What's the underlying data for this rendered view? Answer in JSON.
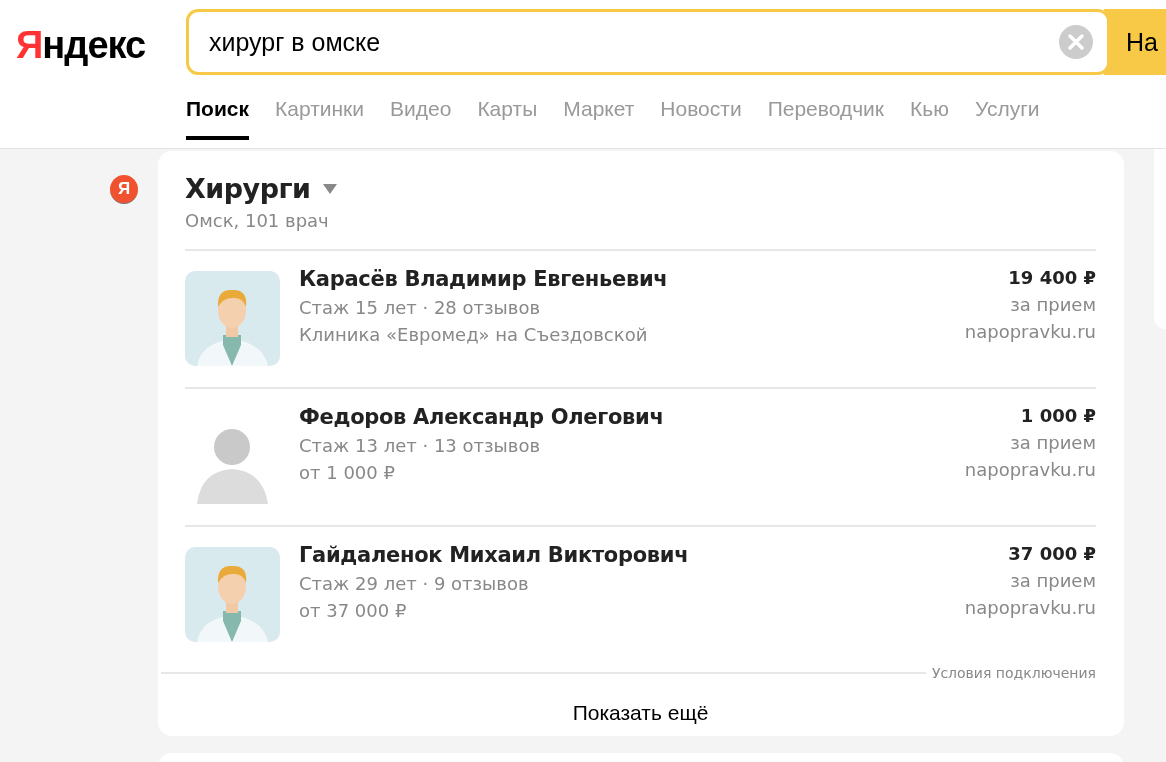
{
  "logo": {
    "first": "Я",
    "rest": "ндекс"
  },
  "search": {
    "value": "хирург в омске",
    "button": "На"
  },
  "tabs": [
    {
      "label": "Поиск",
      "selected": true
    },
    {
      "label": "Картинки",
      "selected": false
    },
    {
      "label": "Видео",
      "selected": false
    },
    {
      "label": "Карты",
      "selected": false
    },
    {
      "label": "Маркет",
      "selected": false
    },
    {
      "label": "Новости",
      "selected": false
    },
    {
      "label": "Переводчик",
      "selected": false
    },
    {
      "label": "Кью",
      "selected": false
    },
    {
      "label": "Услуги",
      "selected": false
    }
  ],
  "source_badge": "Я",
  "card": {
    "title": "Хирурги",
    "subtitle": "Омск, 101 врач",
    "doctors": [
      {
        "kind": "illustration",
        "name": "Карасёв Владимир Евгеньевич",
        "experience": "Стаж 15 лет · 28 отзывов",
        "detail": "Клиника «Евромед» на Съездовской",
        "price": "19 400 ₽",
        "price_note": "за прием",
        "source": "napopravku.ru"
      },
      {
        "kind": "photo",
        "name": "Федоров Александр Олегович",
        "experience": "Стаж 13 лет · 13 отзывов",
        "detail": "от 1 000 ₽",
        "price": "1 000 ₽",
        "price_note": "за прием",
        "source": "napopravku.ru"
      },
      {
        "kind": "illustration",
        "name": "Гайдаленок Михаил Викторович",
        "experience": "Стаж 29 лет · 9 отзывов",
        "detail": "от 37 000 ₽",
        "price": "37 000 ₽",
        "price_note": "за прием",
        "source": "napopravku.ru"
      }
    ],
    "terms_link": "Условия подключения",
    "more_button": "Показать ещё"
  }
}
